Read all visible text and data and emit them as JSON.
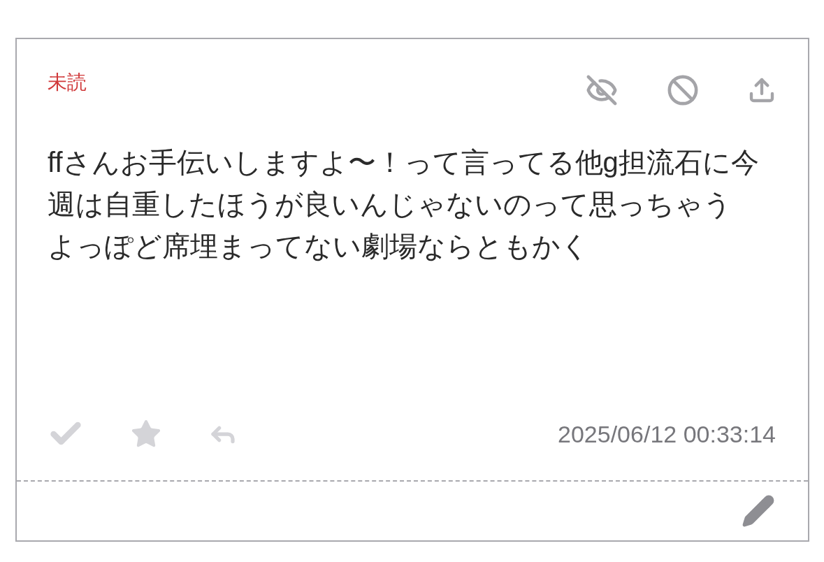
{
  "message": {
    "status": "未読",
    "paragraphs": [
      "ffさんお手伝いしますよ〜！って言ってる他g担流石に今週は自重したほうが良いんじゃないのって思っちゃう",
      "よっぽど席埋まってない劇場ならともかく"
    ],
    "done": false,
    "favorite": false,
    "timestamp": "2025/06/12 00:33:14"
  }
}
